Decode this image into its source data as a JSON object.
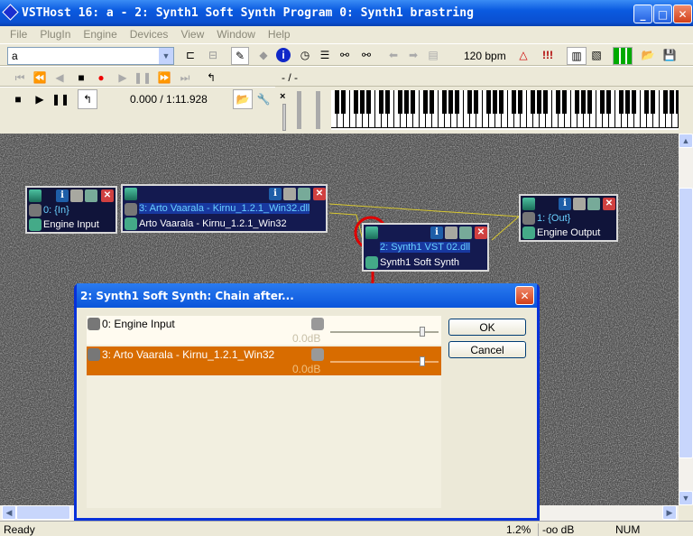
{
  "window": {
    "title": "VSTHost 16: a - 2: Synth1 Soft Synth Program 0: Synth1 brastring",
    "minimize": "_",
    "maximize": "□",
    "close": "✕"
  },
  "menu": [
    "File",
    "PlugIn",
    "Engine",
    "Devices",
    "View",
    "Window",
    "Help"
  ],
  "toolbar": {
    "combo_value": "a",
    "bpm": "120 bpm",
    "position_placeholder": "- / -",
    "alert": "!!!"
  },
  "player": {
    "time": "0.000 / 1:11.928",
    "close": "×"
  },
  "nodes": [
    {
      "line1": "0: {In}",
      "line2": "Engine Input"
    },
    {
      "line1": "3: Arto Vaarala - Kirnu_1.2.1_Win32.dll",
      "line2": "Arto Vaarala - Kirnu_1.2.1_Win32"
    },
    {
      "line1": "2: Synth1 VST 02.dll",
      "line2": "Synth1 Soft Synth"
    },
    {
      "line1": "1: {Out}",
      "line2": "Engine Output"
    }
  ],
  "dialog": {
    "title": "2: Synth1 Soft Synth: Chain after...",
    "close": "✕",
    "ok": "OK",
    "cancel": "Cancel",
    "items": [
      {
        "label": "0: Engine Input",
        "gain": "0.0dB",
        "selected": false,
        "level": 0.85
      },
      {
        "label": "3: Arto Vaarala - Kirnu_1.2.1_Win32",
        "gain": "0.0dB",
        "selected": true,
        "level": 0.85
      }
    ]
  },
  "status": {
    "text": "Ready",
    "cpu": "1.2%",
    "level": "-oo dB",
    "num": "NUM"
  },
  "colors": {
    "selected_row": "#d86c00",
    "title_blue": "#0a55da",
    "highlight_red": "#e00000"
  }
}
